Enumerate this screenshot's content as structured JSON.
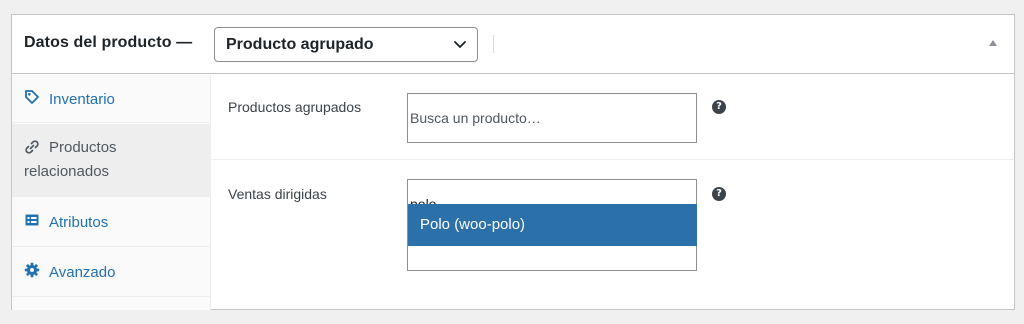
{
  "header": {
    "title": "Datos del producto —",
    "product_type": "Producto agrupado"
  },
  "tabs": [
    {
      "label": "Inventario",
      "icon": "tag-icon"
    },
    {
      "label": "Productos",
      "label2": "relacionados",
      "icon": "link-icon"
    },
    {
      "label": "Atributos",
      "icon": "list-icon"
    },
    {
      "label": "Avanzado",
      "icon": "gear-icon"
    }
  ],
  "fields": {
    "grouped": {
      "label": "Productos agrupados",
      "placeholder": "Busca un producto…"
    },
    "upsells": {
      "label": "Ventas dirigidas",
      "value": "polo",
      "option": "Polo (woo-polo)"
    }
  },
  "colors": {
    "accent": "#2271b1",
    "highlight": "#2c70a9"
  }
}
